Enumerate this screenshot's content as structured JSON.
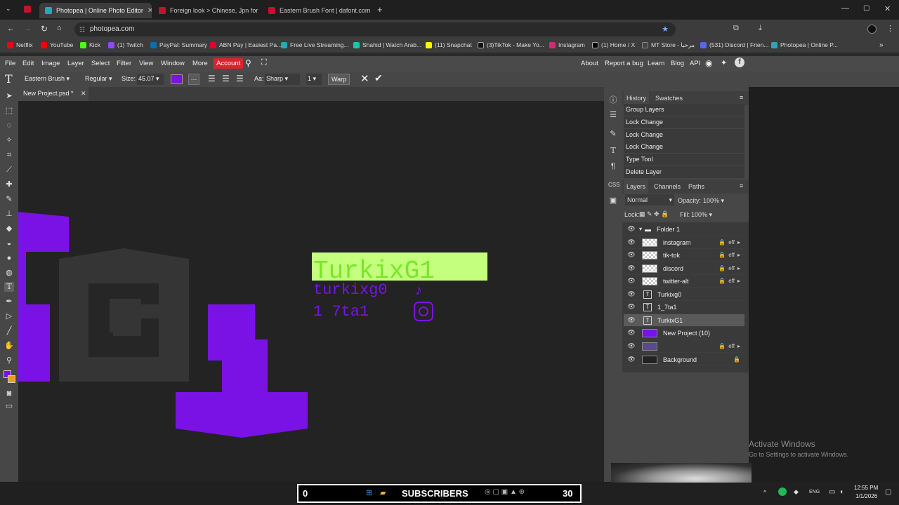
{
  "browser": {
    "tabs": [
      {
        "title": "Photopea | Online Photo Editor",
        "color": "#2aa7b3"
      },
      {
        "title": "Foreign look > Chinese, Jpn for",
        "color": "#c8102e"
      },
      {
        "title": "Eastern Brush Font | dafont.com",
        "color": "#c8102e"
      }
    ],
    "url": "photopea.com",
    "bookmarks": [
      {
        "label": "Netflix",
        "color": "#e50914"
      },
      {
        "label": "YouTube",
        "color": "#ff0000"
      },
      {
        "label": "Kick",
        "color": "#53fc18"
      },
      {
        "label": "(1) Twitch",
        "color": "#9146ff"
      },
      {
        "label": "PayPal: Summary",
        "color": "#0070ba"
      },
      {
        "label": "ABN Pay | Easiest Pa...",
        "color": "#e4002b"
      },
      {
        "label": "Free Live Streaming...",
        "color": "#2aa7b3"
      },
      {
        "label": "Shahid | Watch Arab...",
        "color": "#22c1a8"
      },
      {
        "label": "(11) Snapchat",
        "color": "#fffc00"
      },
      {
        "label": "(3)TikTok - Make Yo...",
        "color": "#111111"
      },
      {
        "label": "Instagram",
        "color": "#d62976"
      },
      {
        "label": "(1) Home / X",
        "color": "#000000"
      },
      {
        "label": "MT Store - مرحبا",
        "color": "#444444"
      },
      {
        "label": "(531) Discord | Frien...",
        "color": "#5865f2"
      },
      {
        "label": "Photopea | Online P...",
        "color": "#2aa7b3"
      }
    ]
  },
  "menubar": {
    "items": [
      "File",
      "Edit",
      "Image",
      "Layer",
      "Select",
      "Filter",
      "View",
      "Window",
      "More"
    ],
    "account": "Account",
    "right_items": [
      "About",
      "Report a bug",
      "Learn",
      "Blog",
      "API"
    ]
  },
  "options": {
    "font": "Eastern Brush",
    "style": "Regular",
    "size_label": "Size:",
    "size_value": "45.07",
    "aa_label": "Aa:",
    "aa_value": "Sharp",
    "tracking": "1",
    "warp": "Warp",
    "text_color": "#7a12e6"
  },
  "document": {
    "tab_title": "New Project.psd *",
    "text_lines": [
      "turkixg0",
      "1 7ta1"
    ],
    "selected_text": "TurkixG1"
  },
  "history": {
    "tabs": [
      "History",
      "Swatches"
    ],
    "items": [
      "Group Layers",
      "Lock Change",
      "Lock Change",
      "Lock Change",
      "Type Tool",
      "Delete Layer"
    ]
  },
  "layers": {
    "tabs": [
      "Layers",
      "Channels",
      "Paths"
    ],
    "blend_mode": "Normal",
    "opacity_label": "Opacity:",
    "opacity_value": "100%",
    "lock_label": "Lock:",
    "fill_label": "Fill:",
    "fill_value": "100%",
    "items": [
      {
        "name": "Folder 1",
        "kind": "folder"
      },
      {
        "name": "instagram",
        "kind": "image"
      },
      {
        "name": "tik-tok",
        "kind": "image"
      },
      {
        "name": "discord",
        "kind": "image"
      },
      {
        "name": "twitter-alt",
        "kind": "image"
      },
      {
        "name": "Turkixg0",
        "kind": "text"
      },
      {
        "name": "1_7ta1",
        "kind": "text"
      },
      {
        "name": "TurkixG1",
        "kind": "text"
      },
      {
        "name": "New Project (10)",
        "kind": "image"
      },
      {
        "name": "",
        "kind": "image"
      },
      {
        "name": "Background",
        "kind": "bg"
      }
    ],
    "eff": "eff"
  },
  "watermark": {
    "title": "Activate Windows",
    "subtitle": "Go to Settings to activate Windows."
  },
  "taskbar": {
    "left_counter": "0",
    "banner": "SUBSCRIBERS",
    "right_counter": "30",
    "lang": "ENG",
    "time": "12:55 PM",
    "date": "1/1/2026"
  }
}
